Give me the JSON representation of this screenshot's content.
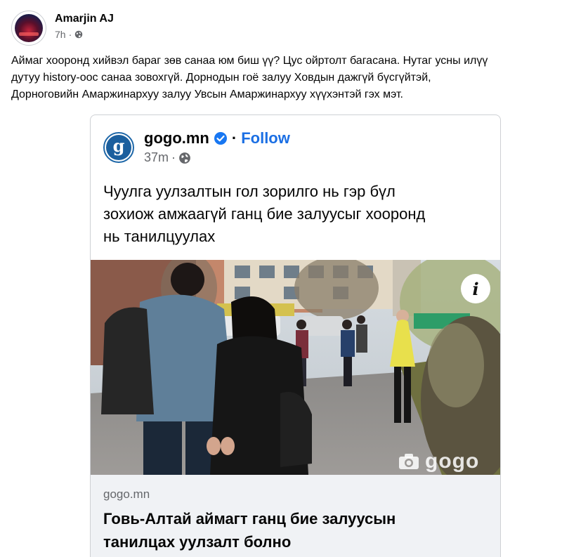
{
  "post": {
    "author": "Amarjin AJ",
    "time": "7h",
    "dot": "·",
    "privacy_icon": "globe-icon",
    "text_lines": [
      "Аймаг хооронд хийвэл бараг зөв санаа юм биш үү? Цус ойртолт багасана. Нутаг усны илүү",
      "дутуу history-оос санаа зовохгүй. Дорнодын гоё залуу Ховдын дажгүй бүсгүйтэй,",
      "Дорноговийн Амаржинархуу залуу Увсын Амаржинархуу хүүхэнтэй гэх мэт."
    ]
  },
  "shared": {
    "page_logo_letter": "g",
    "page_name": "gogo.mn",
    "verified_icon": "verified-badge-icon",
    "dot": "·",
    "follow_label": "Follow",
    "time": "37m",
    "text_lines": [
      "Чуулга уулзалтын гол зорилго нь гэр бүл",
      "зохиож амжаагүй ганц бие залуусыг хооронд",
      "нь танилцуулах"
    ],
    "photo": {
      "info_label": "i",
      "watermark": "gogo",
      "camera_icon": "camera-icon"
    },
    "link": {
      "domain": "gogo.mn",
      "title_lines": [
        "Говь-Алтай аймагт ганц бие залуусын",
        "танилцах уулзалт болно"
      ]
    }
  },
  "colors": {
    "link_blue": "#1b6fe4",
    "verified_blue": "#1877f2",
    "meta_gray": "#65676b",
    "footer_bg": "#f0f2f5",
    "logo_blue": "#1b5f9e"
  }
}
